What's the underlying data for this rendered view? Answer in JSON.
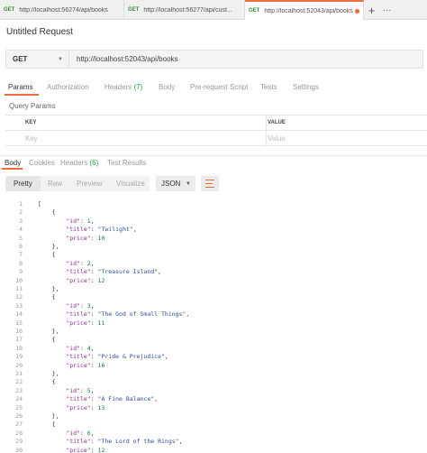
{
  "tabs": [
    {
      "method": "GET",
      "url": "http://localhost:56274/api/books"
    },
    {
      "method": "GET",
      "url": "http://localhost:56277/api/cust..."
    },
    {
      "method": "GET",
      "url": "http://localhost:52043/api/books"
    }
  ],
  "tab_actions": {
    "add": "+",
    "more": "···"
  },
  "request": {
    "title": "Untitled Request",
    "method": "GET",
    "url": "http://localhost:52043/api/books"
  },
  "request_tabs": {
    "params": "Params",
    "authorization": "Authorization",
    "headers": "Headers",
    "headers_count": "(7)",
    "body": "Body",
    "prerequest": "Pre-request Script",
    "tests": "Tests",
    "settings": "Settings"
  },
  "query_params": {
    "label": "Query Params",
    "col_key": "KEY",
    "col_value": "VALUE",
    "key_placeholder": "Key",
    "value_placeholder": "Value"
  },
  "response_tabs": {
    "body": "Body",
    "cookies": "Cookies",
    "headers": "Headers",
    "headers_count": "(6)",
    "test_results": "Test Results"
  },
  "view": {
    "pretty": "Pretty",
    "raw": "Raw",
    "preview": "Preview",
    "visualize": "Visualize",
    "format": "JSON"
  },
  "code_lines": [
    "[",
    "    {",
    "        \"id\": 1,",
    "        \"title\": \"Twilight\",",
    "        \"price\": 10",
    "    },",
    "    {",
    "        \"id\": 2,",
    "        \"title\": \"Treasure Island\",",
    "        \"price\": 12",
    "    },",
    "    {",
    "        \"id\": 3,",
    "        \"title\": \"The God of Small Things\",",
    "        \"price\": 11",
    "    },",
    "    {",
    "        \"id\": 4,",
    "        \"title\": \"Pride & Prejudice\",",
    "        \"price\": 16",
    "    },",
    "    {",
    "        \"id\": 5,",
    "        \"title\": \"A Fine Balance\",",
    "        \"price\": 13",
    "    },",
    "    {",
    "        \"id\": 6,",
    "        \"title\": \"The Lord of the Rings\",",
    "        \"price\": 12"
  ],
  "colors": {
    "accent": "#f26b3a",
    "count_green": "#2aa14a"
  }
}
